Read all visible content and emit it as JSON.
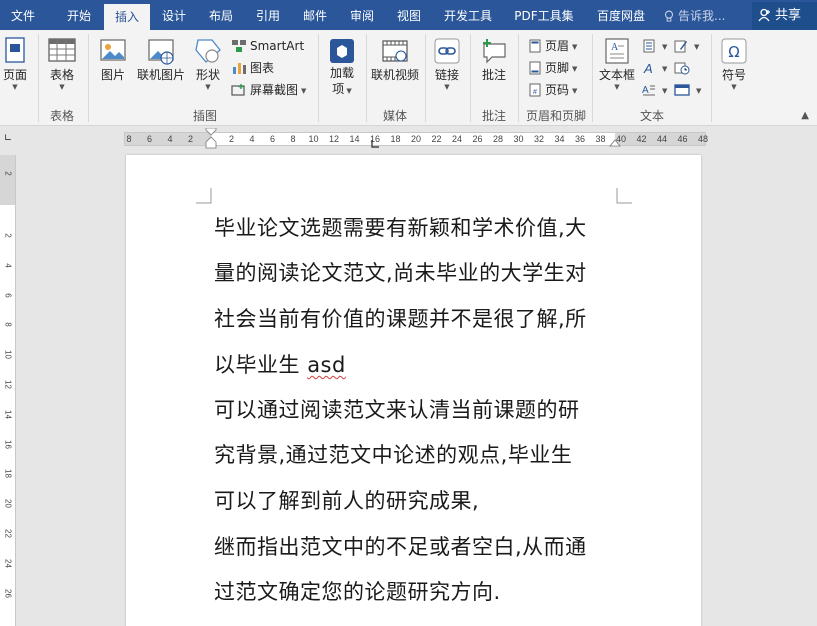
{
  "tabs": [
    {
      "label": "文件",
      "active": false
    },
    {
      "label": "开始",
      "active": false
    },
    {
      "label": "插入",
      "active": true
    },
    {
      "label": "设计",
      "active": false
    },
    {
      "label": "布局",
      "active": false
    },
    {
      "label": "引用",
      "active": false
    },
    {
      "label": "邮件",
      "active": false
    },
    {
      "label": "审阅",
      "active": false
    },
    {
      "label": "视图",
      "active": false
    },
    {
      "label": "开发工具",
      "active": false
    },
    {
      "label": "PDF工具集",
      "active": false
    },
    {
      "label": "百度网盘",
      "active": false
    }
  ],
  "tell_me": "告诉我...",
  "share": "共享",
  "ribbon": {
    "page": "页面",
    "table": "表格",
    "picture": "图片",
    "online_picture": "联机图片",
    "shapes": "形状",
    "smartart": "SmartArt",
    "chart": "图表",
    "screenshot": "屏幕截图",
    "addins_1": "加载",
    "addins_2": "项",
    "online_video": "联机视频",
    "link": "链接",
    "comment": "批注",
    "header": "页眉",
    "footer": "页脚",
    "page_number": "页码",
    "textbox": "文本框",
    "symbol": "符号",
    "groups": {
      "table": "表格",
      "illustrations": "插图",
      "media": "媒体",
      "comments": "批注",
      "header_footer": "页眉和页脚",
      "text": "文本"
    }
  },
  "ruler": {
    "h_left": [
      "8",
      "6",
      "4",
      "2"
    ],
    "h_right": [
      "2",
      "4",
      "6",
      "8",
      "10",
      "12",
      "14",
      "16",
      "18",
      "20",
      "22",
      "24",
      "26",
      "28",
      "30",
      "32",
      "34",
      "36",
      "38",
      "40",
      "42",
      "44",
      "46",
      "48"
    ],
    "v": [
      "2",
      "2",
      "4",
      "6",
      "8",
      "10",
      "12",
      "14",
      "16",
      "18",
      "20",
      "22",
      "24",
      "26"
    ]
  },
  "document": {
    "paragraphs": [
      "毕业论文选题需要有新颖和学术价值,大",
      "量的阅读论文范文,尚未毕业的大学生对",
      "社会当前有价值的课题并不是很了解,所",
      "以毕业生 ",
      "可以通过阅读范文来认清当前课题的研",
      "究背景,通过范文中论述的观点,毕业生",
      "可以了解到前人的研究成果,",
      "继而指出范文中的不足或者空白,从而通",
      "过范文确定您的论题研究方向."
    ],
    "misspelled": "asd"
  }
}
